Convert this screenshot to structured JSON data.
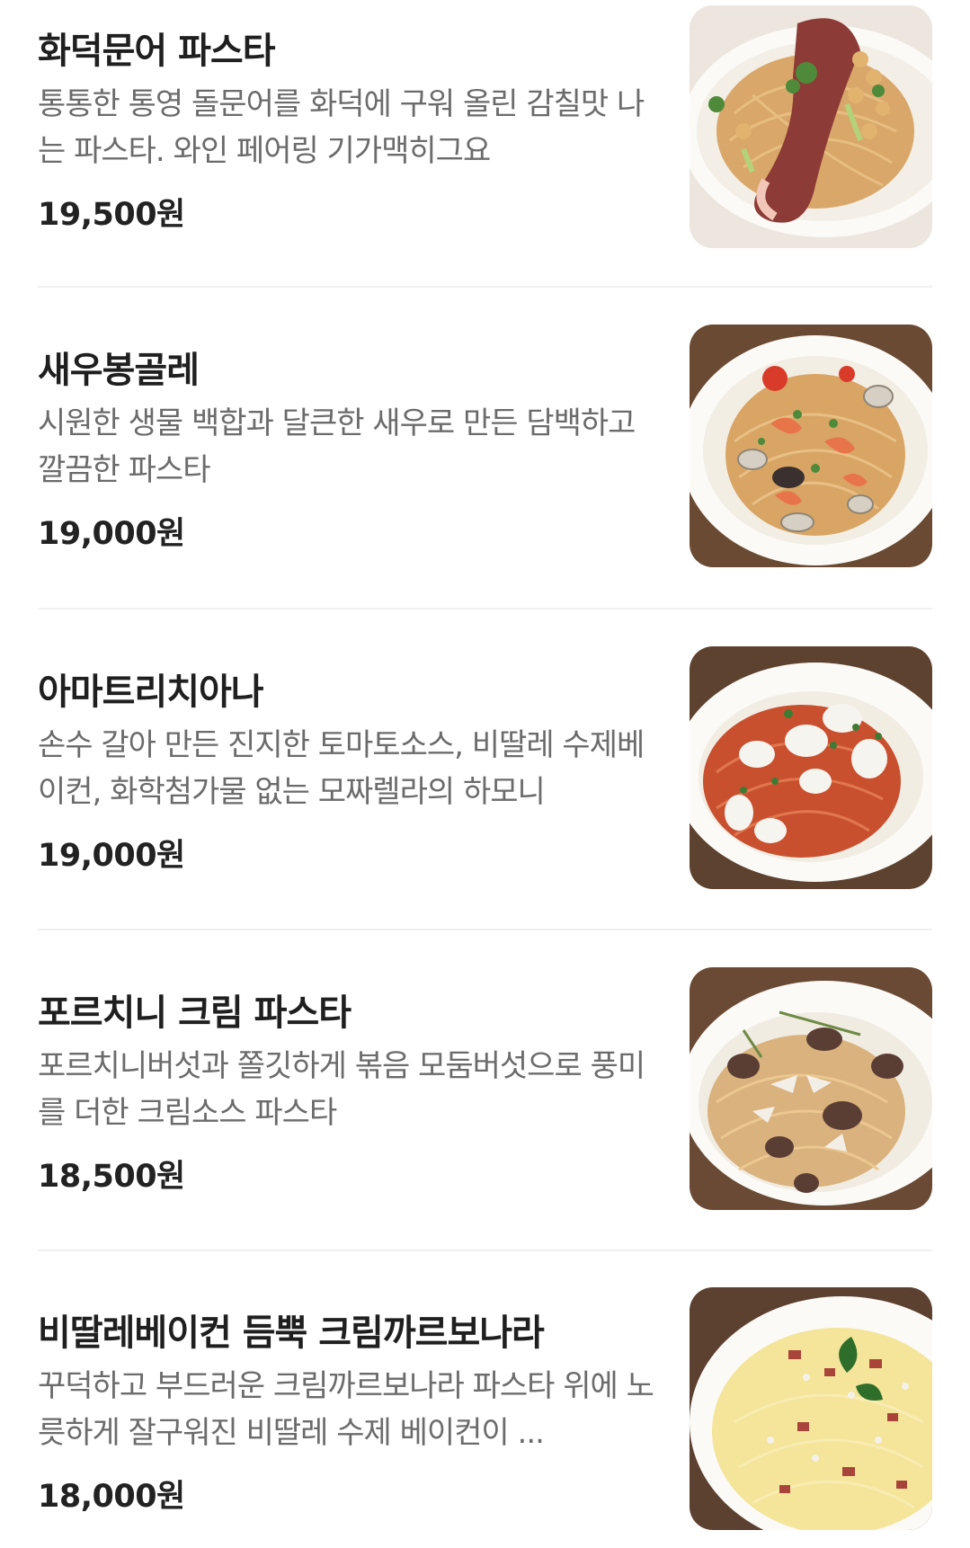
{
  "menu": {
    "items": [
      {
        "name": "화덕문어 파스타",
        "description": "통통한 통영 돌문어를 화덕에 구워 올린 감칠맛 나는 파스타. 와인 페어링 기가맥히그요",
        "price": "19,500원",
        "photo_icon": "octopus-pasta-photo"
      },
      {
        "name": "새우봉골레",
        "description": "시원한 생물 백합과 달큰한 새우로 만든 담백하고 깔끔한 파스타",
        "price": "19,000원",
        "photo_icon": "shrimp-vongole-photo"
      },
      {
        "name": "아마트리치아나",
        "description": "손수 갈아 만든 진지한 토마토소스, 비딸레 수제베이컨, 화학첨가물 없는 모짜렐라의 하모니",
        "price": "19,000원",
        "photo_icon": "amatriciana-photo"
      },
      {
        "name": "포르치니 크림 파스타",
        "description": "포르치니버섯과 쫄깃하게 볶음 모둠버섯으로 풍미를 더한 크림소스 파스타",
        "price": "18,500원",
        "photo_icon": "porcini-cream-pasta-photo"
      },
      {
        "name": "비딸레베이컨 듬뿍 크림까르보나라",
        "description": "꾸덕하고 부드러운 크림까르보나라 파스타 위에 노릇하게 잘구워진 비딸레 수제 베이컨이 ...",
        "price": "18,000원",
        "photo_icon": "carbonara-photo"
      }
    ]
  },
  "colors": {
    "title": "#1f1f1f",
    "description": "#6b6b6b",
    "price": "#222222",
    "divider": "#f0f0f0"
  }
}
